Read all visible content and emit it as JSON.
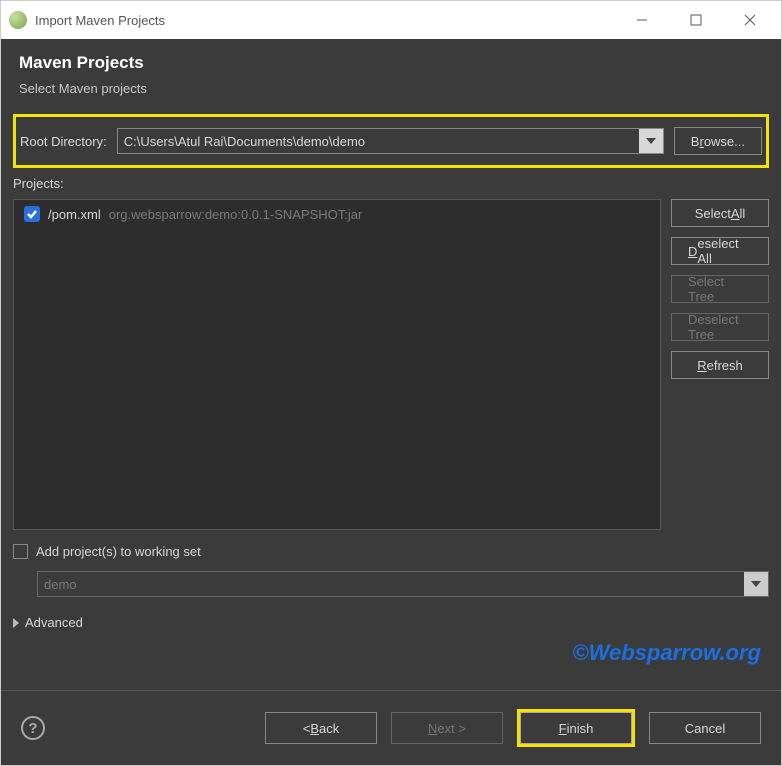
{
  "titlebar": {
    "title": "Import Maven Projects"
  },
  "banner": {
    "heading": "Maven Projects",
    "subtitle": "Select Maven projects"
  },
  "rootDir": {
    "label": "Root Directory:",
    "value": "C:\\Users\\Atul Rai\\Documents\\demo\\demo"
  },
  "browseBtn": {
    "pre": "B",
    "und": "r",
    "post": "owse..."
  },
  "projectsLabel": "Projects:",
  "projectItem": {
    "name": "/pom.xml",
    "desc": "org.websparrow:demo:0.0.1-SNAPSHOT:jar"
  },
  "sideButtons": {
    "selectAll": {
      "pre": "Select ",
      "und": "A",
      "post": "ll"
    },
    "deselectAll": {
      "und": "D",
      "post": "eselect All"
    },
    "selectTree": "Select Tree",
    "deselectTree": "Deselect Tree",
    "refresh": {
      "und": "R",
      "post": "efresh"
    }
  },
  "workingSet": {
    "label": "Add project(s) to working set",
    "selected": "demo"
  },
  "advanced": "Advanced",
  "watermark": "©Websparrow.org",
  "footer": {
    "back": {
      "pre": "< ",
      "und": "B",
      "post": "ack"
    },
    "next": {
      "und": "N",
      "post": "ext >"
    },
    "finish": {
      "und": "F",
      "post": "inish"
    },
    "cancel": "Cancel"
  }
}
